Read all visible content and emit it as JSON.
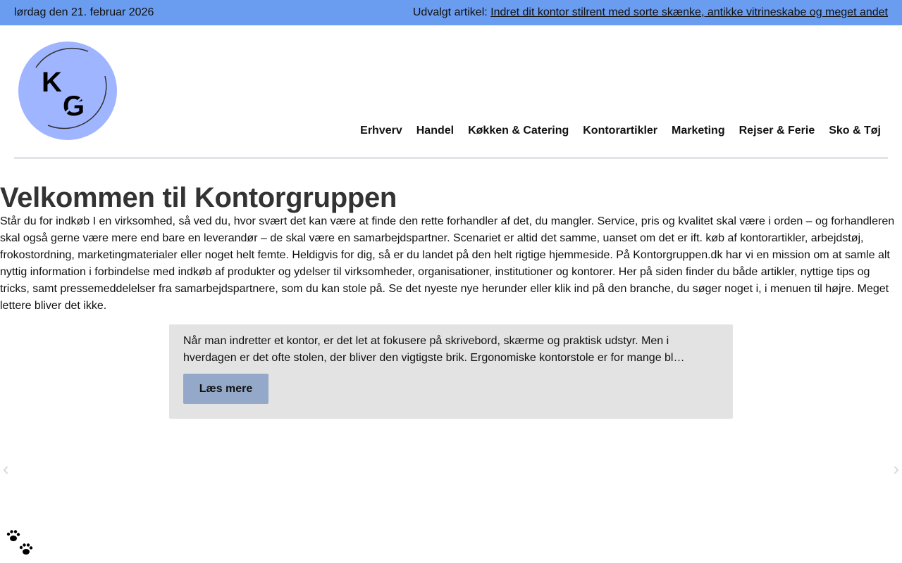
{
  "topbar": {
    "date": "lørdag den 21. februar 2026",
    "featured_label": "Udvalgt artikel:",
    "featured_link": "Indret dit kontor stilrent med sorte skænke, antikke vitrineskabe og meget andet"
  },
  "brand": {
    "logo_text_k": "K",
    "logo_text_g": "G",
    "logo_color": "#9fb5ff"
  },
  "nav": {
    "items": [
      {
        "label": "Erhverv"
      },
      {
        "label": "Handel"
      },
      {
        "label": "Køkken & Catering"
      },
      {
        "label": "Kontorartikler"
      },
      {
        "label": "Marketing"
      },
      {
        "label": "Rejser & Ferie"
      },
      {
        "label": "Sko & Tøj"
      }
    ]
  },
  "main": {
    "title": "Velkommen til Kontorgruppen",
    "intro": "Står du for indkøb I en virksomhed, så ved du, hvor svært det kan være at finde den rette forhandler af det, du mangler. Service, pris og kvalitet skal være i orden – og forhandleren skal også gerne være mere end bare en leverandør – de skal være en samarbejdspartner. Scenariet er altid det samme, uanset om det er ift. køb af kontorartikler, arbejdstøj, frokostordning, marketingmaterialer eller noget helt femte. Heldigvis for dig, så er du landet på den helt rigtige hjemmeside. På Kontorgruppen.dk har vi en mission om at samle alt nyttig information i forbindelse med indkøb af produkter og ydelser til virksomheder, organisationer, institutioner og kontorer. Her på siden finder du både artikler, nyttige tips og tricks, samt pressemeddelelser fra samarbejdspartnere, som du kan stole på. Se det nyeste nye herunder eller klik ind på den branche, du søger noget i, i menuen til højre. Meget lettere bliver det ikke."
  },
  "slider": {
    "excerpt": "Når man indretter et kontor, er det let at fokusere på skrivebord, skærme og praktisk udstyr. Men i hverdagen er det ofte stolen, der bliver den vigtigste brik. Ergonomiske kontorstole er for mange bl…",
    "button_label": "Læs mere",
    "prev_icon": "‹",
    "next_icon": "›"
  },
  "colors": {
    "topbar_bg": "#6a9cf0",
    "card_bg": "#e3e3e3",
    "button_bg": "#94a9c9"
  }
}
